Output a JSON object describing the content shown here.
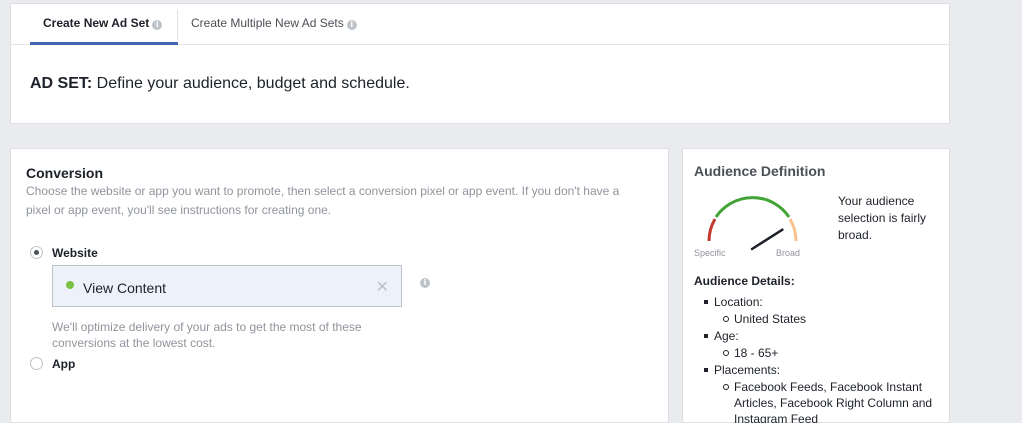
{
  "tabs": [
    {
      "label": "Create New Ad Set",
      "active": true
    },
    {
      "label": "Create Multiple New Ad Sets",
      "active": false
    }
  ],
  "adset": {
    "prefix": "AD SET:",
    "text": " Define your audience, budget and schedule."
  },
  "conversion": {
    "title": "Conversion",
    "description": "Choose the website or app you want to promote, then select a conversion pixel or app event. If you don't have a pixel or app event, you'll see instructions for creating one.",
    "options": [
      {
        "label": "Website",
        "selected": true
      },
      {
        "label": "App",
        "selected": false
      }
    ],
    "event": {
      "label": "View Content",
      "status_color": "#7bc043"
    },
    "note": "We'll optimize delivery of your ads to get the most of these conversions at the lowest cost."
  },
  "audience": {
    "title": "Audience Definition",
    "gauge_specific": "Specific",
    "gauge_broad": "Broad",
    "gauge_level": 0.82,
    "summary": "Your audience selection is fairly broad.",
    "details_title": "Audience Details:",
    "details": [
      {
        "label": "Location:",
        "values": [
          "United States"
        ]
      },
      {
        "label": "Age:",
        "values": [
          "18 - 65+"
        ]
      },
      {
        "label": "Placements:",
        "values": [
          "Facebook Feeds, Facebook Instant Articles, Facebook Right Column and Instagram Feed"
        ]
      }
    ]
  },
  "colors": {
    "accent": "#4267b2",
    "gauge_red": "#c0392b",
    "gauge_green": "#42a336",
    "gauge_orange": "#f7c28b"
  }
}
